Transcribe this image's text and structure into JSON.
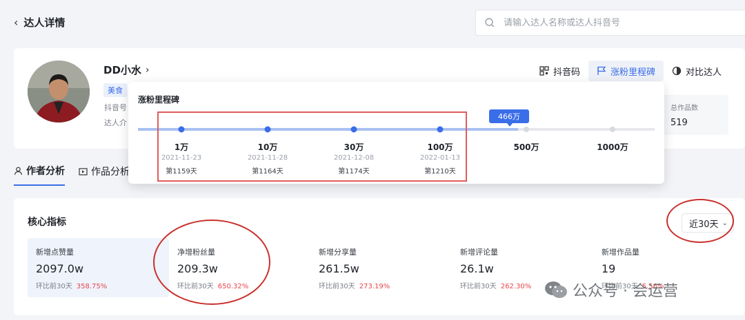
{
  "header": {
    "title": "达人详情",
    "search_placeholder": "请输入达人名称或达人抖音号"
  },
  "profile": {
    "name": "DD小水",
    "tag": "美食",
    "douyin_label": "抖音号",
    "intro_label": "达人介",
    "actions": [
      {
        "label": "抖音码",
        "icon": "qrcode-icon"
      },
      {
        "label": "涨粉里程碑",
        "icon": "flag-icon"
      },
      {
        "label": "对比达人",
        "icon": "compare-icon"
      }
    ],
    "total_works": {
      "label": "总作品数",
      "value": "519"
    }
  },
  "milestone_popover": {
    "title": "涨粉里程碑",
    "current_badge": "466万",
    "current_fraction": 0.466,
    "milestones": [
      {
        "label": "1万",
        "date": "2021-11-23",
        "day": "第1159天",
        "reached": true
      },
      {
        "label": "10万",
        "date": "2021-11-28",
        "day": "第1164天",
        "reached": true
      },
      {
        "label": "30万",
        "date": "2021-12-08",
        "day": "第1174天",
        "reached": true
      },
      {
        "label": "100万",
        "date": "2022-01-13",
        "day": "第1210天",
        "reached": true
      },
      {
        "label": "500万",
        "date": "",
        "day": "",
        "reached": false
      },
      {
        "label": "1000万",
        "date": "",
        "day": "",
        "reached": false
      }
    ]
  },
  "tabs": [
    {
      "label": "作者分析",
      "icon": "user-icon",
      "active": true
    },
    {
      "label": "作品分析",
      "icon": "video-icon",
      "active": false
    }
  ],
  "core_metrics": {
    "title": "核心指标",
    "range": "近30天",
    "items": [
      {
        "label": "新增点赞量",
        "value": "2097.0w",
        "comp": "环比前30天",
        "pct": "358.75%"
      },
      {
        "label": "净增粉丝量",
        "value": "209.3w",
        "comp": "环比前30天",
        "pct": "650.32%"
      },
      {
        "label": "新增分享量",
        "value": "261.5w",
        "comp": "环比前30天",
        "pct": "273.19%"
      },
      {
        "label": "新增评论量",
        "value": "26.1w",
        "comp": "环比前30天",
        "pct": "262.30%"
      },
      {
        "label": "新增作品量",
        "value": "19",
        "comp": "环比前30天",
        "pct": "5.56%"
      }
    ]
  },
  "watermark": "公众号 · 会运营",
  "colors": {
    "accent": "#3a6ee8",
    "up": "#e8454a",
    "annotation": "#c9302c"
  }
}
